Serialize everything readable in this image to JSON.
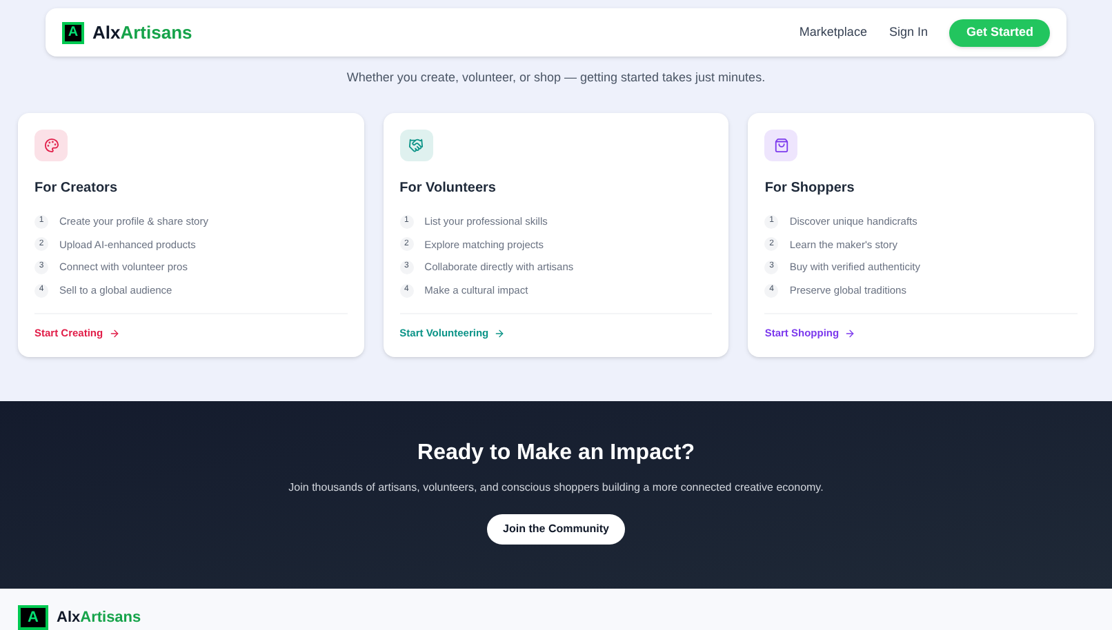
{
  "nav": {
    "logo": {
      "part1": "Alx",
      "part2": "Artisans",
      "mark": "A"
    },
    "links": [
      "Marketplace",
      "Sign In"
    ],
    "cta": "Get Started"
  },
  "subtitle": "Whether you create, volunteer, or shop — getting started takes just minutes.",
  "cards": [
    {
      "kind": "palette",
      "title": "For Creators",
      "color": "#e11d48",
      "steps": [
        {
          "n": "1",
          "text": "Create your profile & share story"
        },
        {
          "n": "2",
          "text": "Upload AI-enhanced products"
        },
        {
          "n": "3",
          "text": "Connect with volunteer pros"
        },
        {
          "n": "4",
          "text": "Sell to a global audience"
        }
      ],
      "link": "Start Creating"
    },
    {
      "kind": "handshake",
      "title": "For Volunteers",
      "color": "#0d9488",
      "steps": [
        {
          "n": "1",
          "text": "List your professional skills"
        },
        {
          "n": "2",
          "text": "Explore matching projects"
        },
        {
          "n": "3",
          "text": "Collaborate directly with artisans"
        },
        {
          "n": "4",
          "text": "Make a cultural impact"
        }
      ],
      "link": "Start Volunteering"
    },
    {
      "kind": "bag",
      "title": "For Shoppers",
      "color": "#7c3aed",
      "steps": [
        {
          "n": "1",
          "text": "Discover unique handicrafts"
        },
        {
          "n": "2",
          "text": "Learn the maker's story"
        },
        {
          "n": "3",
          "text": "Buy with verified authenticity"
        },
        {
          "n": "4",
          "text": "Preserve global traditions"
        }
      ],
      "link": "Start Shopping"
    }
  ],
  "cta_section": {
    "title": "Ready to Make an Impact?",
    "text": "Join thousands of artisans, volunteers, and conscious shoppers building a more connected creative economy.",
    "button": "Join the Community"
  },
  "footer": {
    "logo": {
      "part1": "Alx",
      "part2": "Artisans",
      "mark": "A"
    }
  }
}
